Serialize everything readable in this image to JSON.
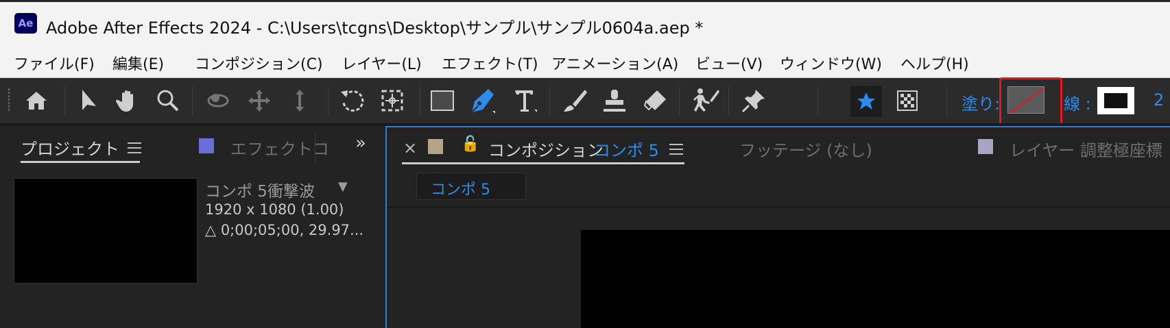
{
  "window": {
    "logo_text": "Ae",
    "title": "Adobe After Effects 2024 - C:\\Users\\tcgns\\Desktop\\サンプル\\サンプル0604a.aep *"
  },
  "menu": [
    "ファイル(F)",
    "編集(E)",
    "コンポジション(C)",
    "レイヤー(L)",
    "エフェクト(T)",
    "アニメーション(A)",
    "ビュー(V)",
    "ウィンドウ(W)",
    "ヘルプ(H)"
  ],
  "toolbar": {
    "fill_label": "塗り:",
    "stroke_label": "線 :",
    "stroke_width": "2",
    "active_tool": "pen-tool",
    "accent_color": "#2d8ceb",
    "highlight_color": "#e8141e"
  },
  "project_panel": {
    "tab_label": "プロジェクト",
    "effects_tab_label": "エフェクトコ",
    "overflow_glyph": "»",
    "item_name": "コンポ 5衝撃波",
    "dropdown_glyph": "▼",
    "resolution": "1920 x 1080 (1.00)",
    "duration": "△ 0;00;05;00, 29.97..."
  },
  "comp_panel": {
    "close_glyph": "×",
    "lock_glyph": "🔓",
    "tab_prefix": "コンポジション",
    "tab_name": "コンポ 5",
    "footage_tab": "フッテージ (なし)",
    "layer_tab": "レイヤー 調整極座標",
    "subtab_label": "コンポ 5"
  }
}
